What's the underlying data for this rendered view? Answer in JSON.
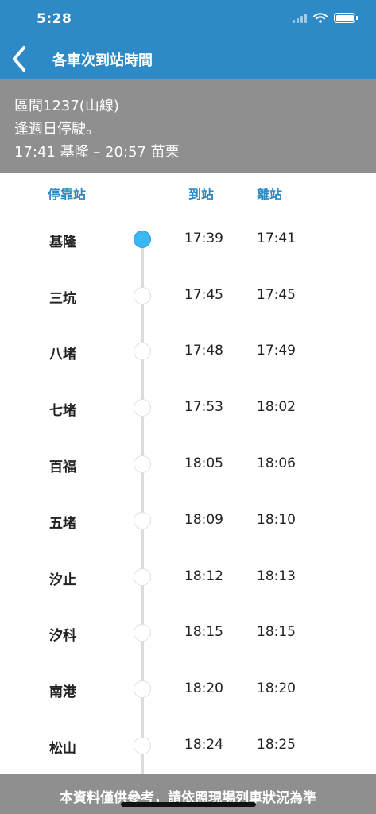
{
  "status_bar": {
    "time": "5:28"
  },
  "nav": {
    "title": "各車次到站時間"
  },
  "train": {
    "name": "區間1237(山線)",
    "note": "逢週日停駛。",
    "route": "17:41 基隆 – 20:57 苗栗"
  },
  "columns": {
    "station": "停靠站",
    "arrive": "到站",
    "depart": "離站"
  },
  "stops": [
    {
      "station": "基隆",
      "arrive": "17:39",
      "depart": "17:41",
      "current": true
    },
    {
      "station": "三坑",
      "arrive": "17:45",
      "depart": "17:45"
    },
    {
      "station": "八堵",
      "arrive": "17:48",
      "depart": "17:49"
    },
    {
      "station": "七堵",
      "arrive": "17:53",
      "depart": "18:02"
    },
    {
      "station": "百福",
      "arrive": "18:05",
      "depart": "18:06"
    },
    {
      "station": "五堵",
      "arrive": "18:09",
      "depart": "18:10"
    },
    {
      "station": "汐止",
      "arrive": "18:12",
      "depart": "18:13"
    },
    {
      "station": "汐科",
      "arrive": "18:15",
      "depart": "18:15"
    },
    {
      "station": "南港",
      "arrive": "18:20",
      "depart": "18:20"
    },
    {
      "station": "松山",
      "arrive": "18:24",
      "depart": "18:25"
    }
  ],
  "footer": {
    "note": "本資料僅供參考，請依照現場列車狀況為準"
  },
  "colors": {
    "primary": "#2e8ac6",
    "current_dot": "#3ab8f3",
    "gray_bar": "#8f8f8f"
  },
  "icons": [
    "back-chevron-icon",
    "signal-icon",
    "wifi-icon",
    "battery-icon"
  ]
}
